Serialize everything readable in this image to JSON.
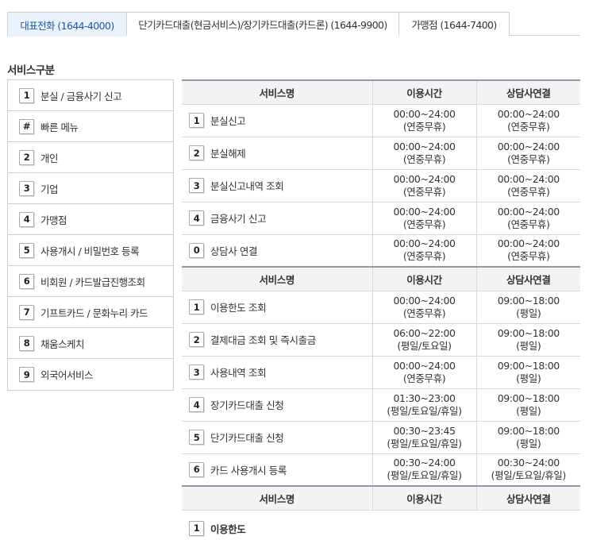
{
  "tabs": [
    {
      "label": "대표전화 (1644-4000)",
      "active": true
    },
    {
      "label": "단기카드대출(현금서비스)/장기카드대출(카드론) (1644-9900)",
      "active": false
    },
    {
      "label": "가맹점 (1644-7400)",
      "active": false
    }
  ],
  "section_title": "서비스구분",
  "menu": [
    {
      "key": "1",
      "label": "분실 / 금융사기 신고"
    },
    {
      "key": "#",
      "label": "빠른 메뉴"
    },
    {
      "key": "2",
      "label": "개인"
    },
    {
      "key": "3",
      "label": "기업"
    },
    {
      "key": "4",
      "label": "가맹점"
    },
    {
      "key": "5",
      "label": "사용개시 / 비밀번호 등록"
    },
    {
      "key": "6",
      "label": "비회원 / 카드발급진행조회"
    },
    {
      "key": "7",
      "label": "기프트카드 / 문화누리 카드"
    },
    {
      "key": "8",
      "label": "채움스케치"
    },
    {
      "key": "9",
      "label": "외국어서비스"
    }
  ],
  "headers": {
    "service": "서비스명",
    "hours": "이용시간",
    "counsel": "상담사연결"
  },
  "group1": [
    {
      "key": "1",
      "name": "분실신고",
      "hours": [
        "00:00~24:00",
        "(연중무휴)"
      ],
      "counsel": [
        "00:00~24:00",
        "(연중무휴)"
      ]
    },
    {
      "key": "2",
      "name": "분실해제",
      "hours": [
        "00:00~24:00",
        "(연중무휴)"
      ],
      "counsel": [
        "00:00~24:00",
        "(연중무휴)"
      ]
    },
    {
      "key": "3",
      "name": "분실신고내역 조회",
      "hours": [
        "00:00~24:00",
        "(연중무휴)"
      ],
      "counsel": [
        "00:00~24:00",
        "(연중무휴)"
      ]
    },
    {
      "key": "4",
      "name": "금융사기 신고",
      "hours": [
        "00:00~24:00",
        "(연중무휴)"
      ],
      "counsel": [
        "00:00~24:00",
        "(연중무휴)"
      ]
    },
    {
      "key": "0",
      "name": "상담사 연결",
      "hours": [
        "00:00~24:00",
        "(연중무휴)"
      ],
      "counsel": [
        "00:00~24:00",
        "(연중무휴)"
      ]
    }
  ],
  "group2": [
    {
      "key": "1",
      "name": "이용한도 조회",
      "hours": [
        "00:00~24:00",
        "(연중무휴)"
      ],
      "counsel": [
        "09:00~18:00",
        "(평일)"
      ]
    },
    {
      "key": "2",
      "name": "결제대금 조회 및 즉시출금",
      "hours": [
        "06:00~22:00",
        "(평일/토요일)"
      ],
      "counsel": [
        "09:00~18:00",
        "(평일)"
      ]
    },
    {
      "key": "3",
      "name": "사용내역 조회",
      "hours": [
        "00:00~24:00",
        "(연중무휴)"
      ],
      "counsel": [
        "09:00~18:00",
        "(평일)"
      ]
    },
    {
      "key": "4",
      "name": "장기카드대출 신청",
      "hours": [
        "01:30~23:00",
        "(평일/토요일/휴일)"
      ],
      "counsel": [
        "09:00~18:00",
        "(평일)"
      ]
    },
    {
      "key": "5",
      "name": "단기카드대출 신청",
      "hours": [
        "00:30~23:45",
        "(평일/토요일/휴일)"
      ],
      "counsel": [
        "09:00~18:00",
        "(평일)"
      ]
    },
    {
      "key": "6",
      "name": "카드 사용개시 등록",
      "hours": [
        "00:30~24:00",
        "(평일/토요일/휴일)"
      ],
      "counsel": [
        "00:30~24:00",
        "(평일/토요일/휴일)"
      ]
    }
  ],
  "group3": [
    {
      "key": "1",
      "name": "이용한도"
    }
  ]
}
